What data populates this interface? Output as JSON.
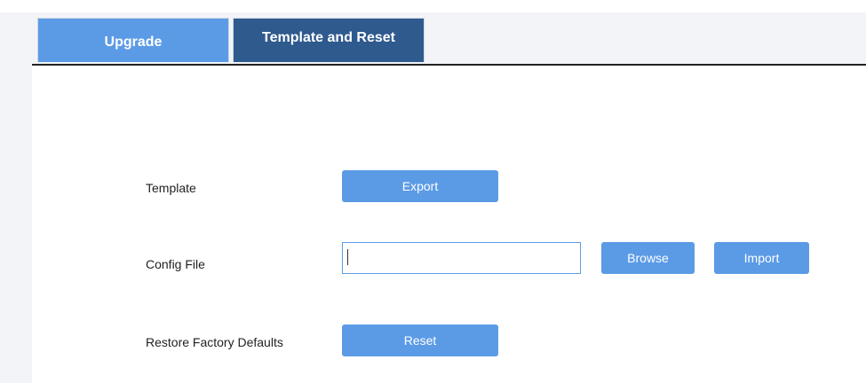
{
  "tabs": [
    {
      "label": "Upgrade",
      "active": false
    },
    {
      "label": "Template and Reset",
      "active": true
    }
  ],
  "template": {
    "label": "Template",
    "export_label": "Export"
  },
  "config_file": {
    "label": "Config File",
    "value": "",
    "placeholder": "",
    "browse_label": "Browse",
    "import_label": "Import"
  },
  "restore": {
    "label": "Restore Factory Defaults",
    "reset_label": "Reset"
  },
  "colors": {
    "accent": "#5b9be6",
    "active_tab": "#2f5a8e",
    "sidebar": "#f2f4f7"
  }
}
